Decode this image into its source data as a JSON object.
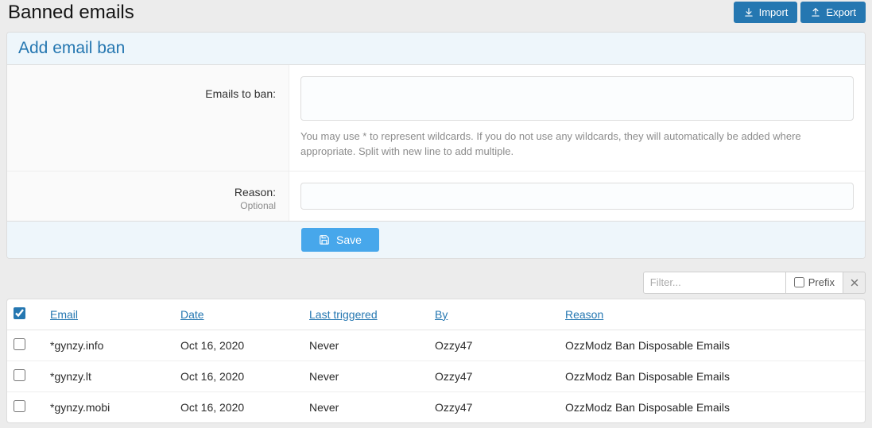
{
  "page_title": "Banned emails",
  "header_buttons": {
    "import": "Import",
    "export": "Export"
  },
  "form": {
    "title": "Add email ban",
    "emails_label": "Emails to ban:",
    "emails_value": "",
    "emails_help": "You may use * to represent wildcards. If you do not use any wildcards, they will automatically be added where appropriate. Split with new line to add multiple.",
    "reason_label": "Reason:",
    "reason_sub": "Optional",
    "reason_value": "",
    "save_label": "Save"
  },
  "filter": {
    "placeholder": "Filter...",
    "prefix_label": "Prefix"
  },
  "table": {
    "headers": {
      "email": "Email",
      "date": "Date",
      "last_triggered": "Last triggered",
      "by": "By",
      "reason": "Reason"
    },
    "rows": [
      {
        "email": "*gynzy.info",
        "date": "Oct 16, 2020",
        "last_triggered": "Never",
        "by": "Ozzy47",
        "reason": "OzzModz Ban Disposable Emails"
      },
      {
        "email": "*gynzy.lt",
        "date": "Oct 16, 2020",
        "last_triggered": "Never",
        "by": "Ozzy47",
        "reason": "OzzModz Ban Disposable Emails"
      },
      {
        "email": "*gynzy.mobi",
        "date": "Oct 16, 2020",
        "last_triggered": "Never",
        "by": "Ozzy47",
        "reason": "OzzModz Ban Disposable Emails"
      }
    ]
  }
}
